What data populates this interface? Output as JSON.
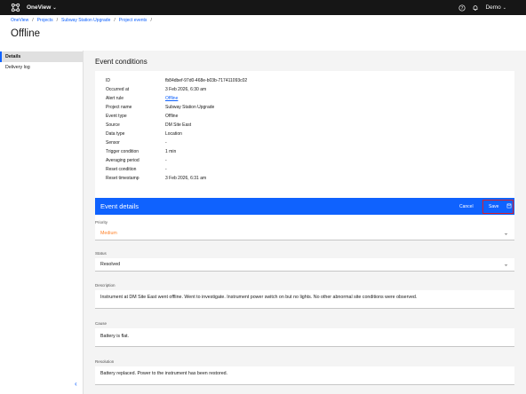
{
  "topbar": {
    "app_title": "OneView",
    "user": "Demo"
  },
  "breadcrumb": [
    "OneView",
    "Projects",
    "Subway Station Upgrade",
    "Project events"
  ],
  "page_title": "Offline",
  "sidebar": {
    "items": [
      "Details",
      "Delivery log"
    ]
  },
  "conditions": {
    "title": "Event conditions",
    "rows": [
      {
        "k": "ID",
        "v": "fb84dbef-97d0-468e-b03b-717411093c02"
      },
      {
        "k": "Occurred at",
        "v": "3 Feb 2026, 6:30 am"
      },
      {
        "k": "Alert rule",
        "v": "Offline"
      },
      {
        "k": "Project name",
        "v": "Subway Station Upgrade"
      },
      {
        "k": "Event type",
        "v": "Offline"
      },
      {
        "k": "Source",
        "v": "DM Site East"
      },
      {
        "k": "Data type",
        "v": "Location"
      },
      {
        "k": "Sensor",
        "v": "-"
      },
      {
        "k": "Trigger condition",
        "v": "1 min"
      },
      {
        "k": "Averaging period",
        "v": "-"
      },
      {
        "k": "Reset condition",
        "v": "-"
      },
      {
        "k": "Reset timestamp",
        "v": "3 Feb 2026, 6:31 am"
      }
    ]
  },
  "details": {
    "title": "Event details",
    "cancel": "Cancel",
    "save": "Save",
    "priority_label": "Priority",
    "priority": "Medium",
    "status_label": "Status",
    "status": "Resolved",
    "description_label": "Description",
    "description": "Instrument at DM Site East went offline. Went to investigate. Instrument power switch on but no lights. No other abnormal site conditions were observed.",
    "cause_label": "Cause",
    "cause": "Battery is flat.",
    "resolution_label": "Resolution",
    "resolution": "Battery replaced. Power to the instrument has been restored."
  },
  "colors": {
    "accent": "#0f62fe",
    "topbar": "#161616",
    "priority": "#ff832b",
    "highlight": "#da1e28"
  },
  "icons": [
    "app-switcher-icon",
    "chevron-down-icon",
    "help-icon",
    "notification-icon",
    "save-icon",
    "collapse-chevron-icon"
  ]
}
